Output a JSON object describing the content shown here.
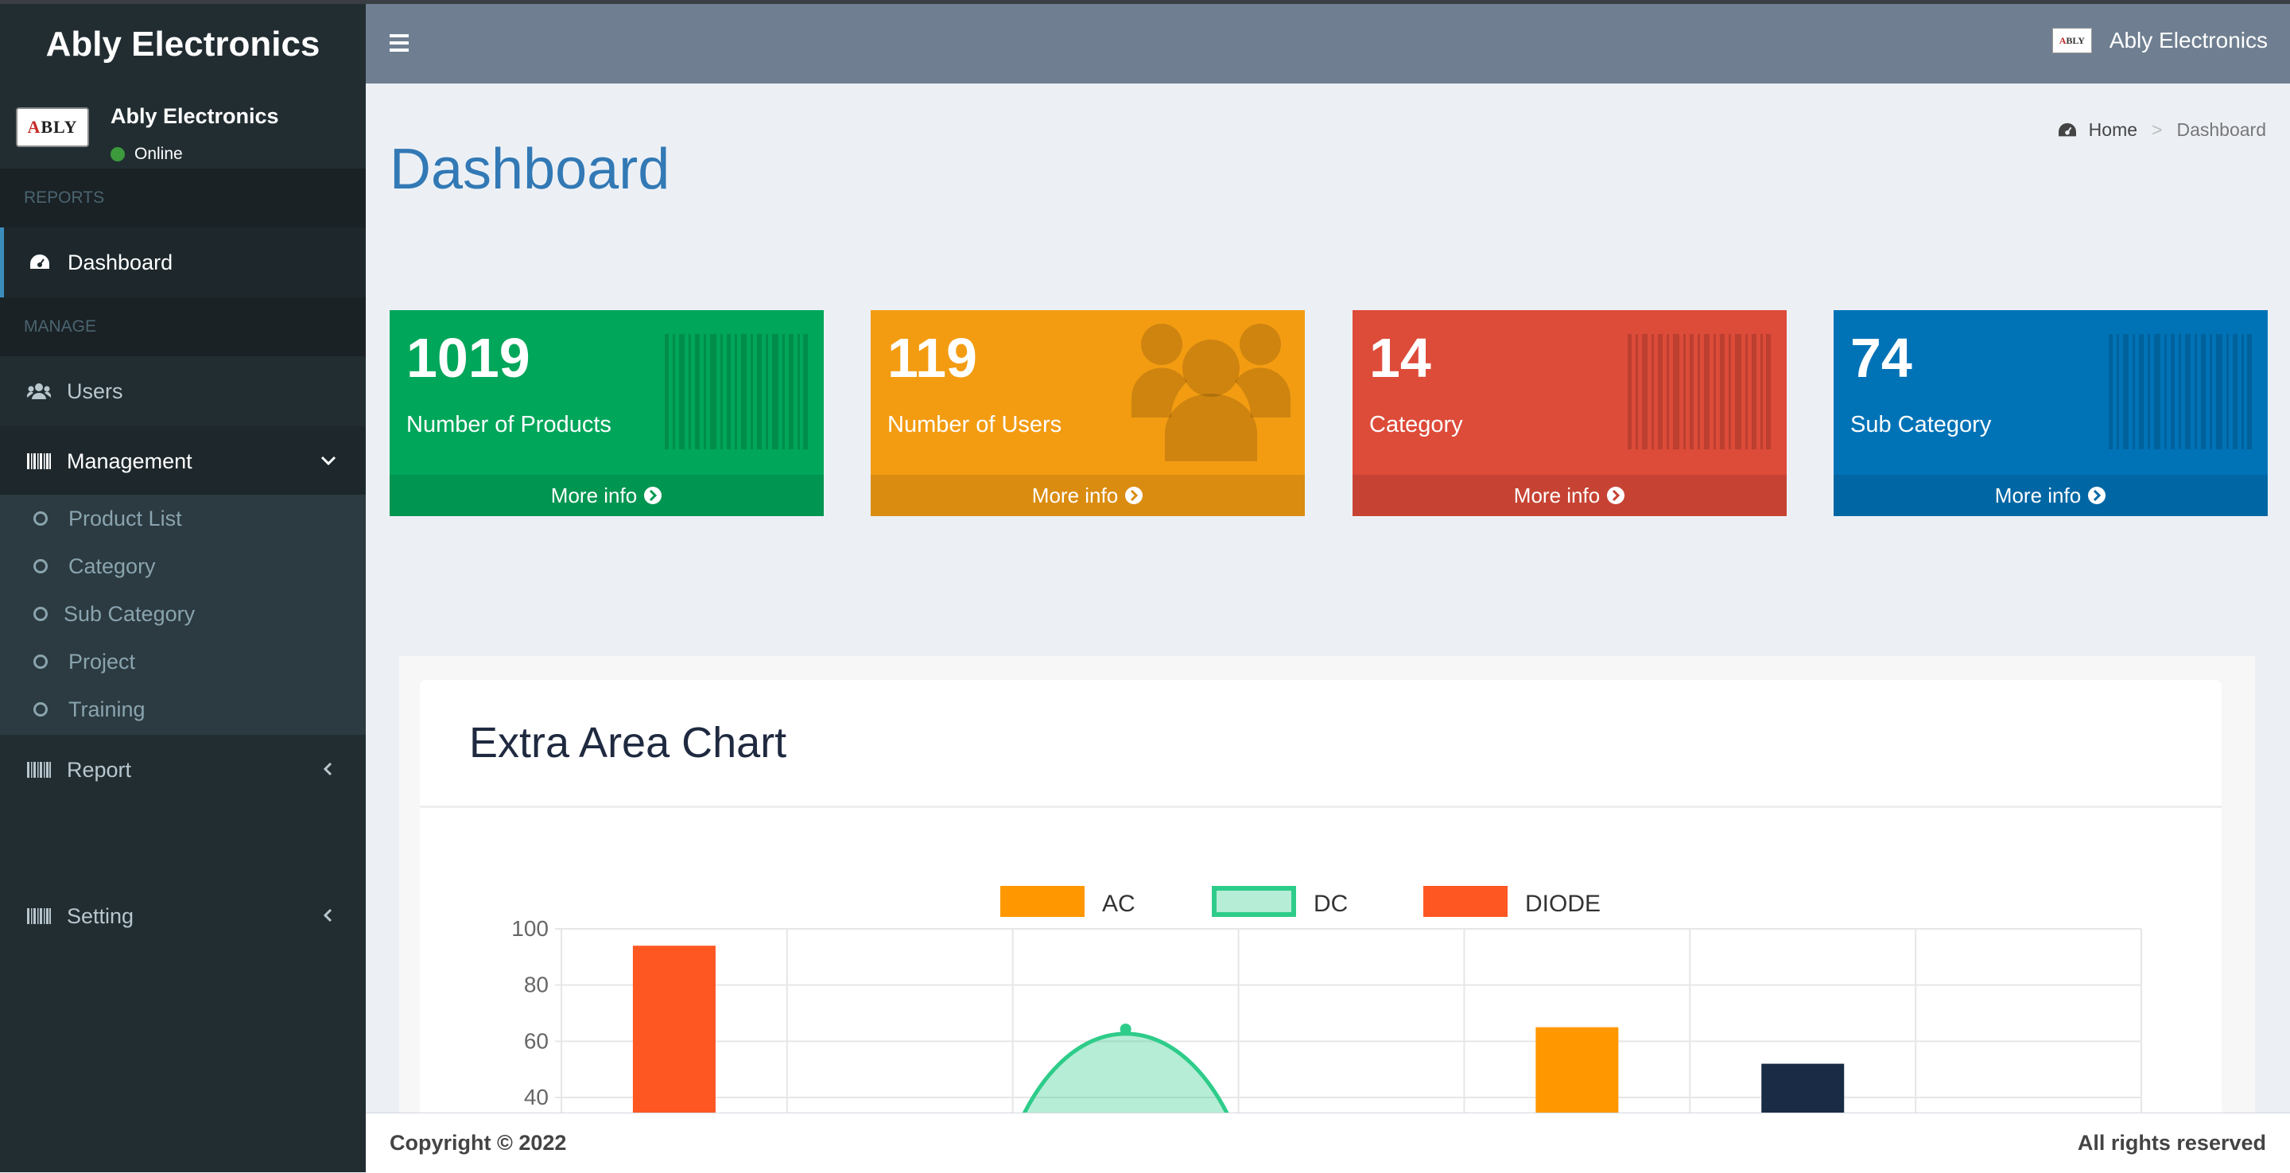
{
  "app": {
    "brand": "Ably Electronics",
    "logo_text": "ABLY"
  },
  "sidebar": {
    "user_name": "Ably Electronics",
    "user_status": "Online",
    "section_reports": "REPORTS",
    "section_manage": "MANAGE",
    "items": [
      {
        "label": "Dashboard",
        "icon": "dashboard-icon"
      },
      {
        "label": "Users",
        "icon": "users-icon"
      },
      {
        "label": "Management",
        "icon": "barcode-icon"
      },
      {
        "label": "Report",
        "icon": "barcode-icon"
      },
      {
        "label": "Setting",
        "icon": "barcode-icon"
      }
    ],
    "submenu": [
      "Product List",
      "Category",
      "Sub Category",
      "Project",
      "Training"
    ]
  },
  "header": {
    "user_label": "Ably Electronics"
  },
  "page": {
    "title": "Dashboard"
  },
  "breadcrumb": {
    "home": "Home",
    "separator": ">",
    "current": "Dashboard"
  },
  "stats": [
    {
      "value": "1019",
      "label": "Number of Products",
      "more": "More info",
      "color": "#00a65a",
      "icon": "barcode-icon"
    },
    {
      "value": "119",
      "label": "Number of Users",
      "more": "More info",
      "color": "#f39c12",
      "icon": "users-icon"
    },
    {
      "value": "14",
      "label": "Category",
      "more": "More info",
      "color": "#dd4b39",
      "icon": "barcode-icon"
    },
    {
      "value": "74",
      "label": "Sub Category",
      "more": "More info",
      "color": "#0073b7",
      "icon": "barcode-icon"
    }
  ],
  "chart": {
    "title": "Extra Area Chart"
  },
  "chart_data": {
    "type": "bar",
    "title": "Extra Area Chart",
    "legend": [
      {
        "name": "AC",
        "color": "#ff9800"
      },
      {
        "name": "DC",
        "color": "#2ecc8a"
      },
      {
        "name": "DIODE",
        "color": "#ff5722"
      }
    ],
    "legend_position": "top-center",
    "yticks": [
      40,
      60,
      80,
      100
    ],
    "ylim": [
      40,
      100
    ],
    "grid": true,
    "bars": [
      {
        "slot": 0,
        "value": 94,
        "color": "#ff5722"
      },
      {
        "slot": 4,
        "value": 65,
        "color": "#ff9800"
      },
      {
        "slot": 5,
        "value": 52,
        "color": "#1a2b45"
      }
    ],
    "area_series": {
      "name": "DC",
      "peak_slot": 2.5,
      "peak_value": 66,
      "color": "#2ecc8a"
    }
  },
  "footer": {
    "copyright": "Copyright © 2022",
    "rights": "All rights reserved"
  }
}
